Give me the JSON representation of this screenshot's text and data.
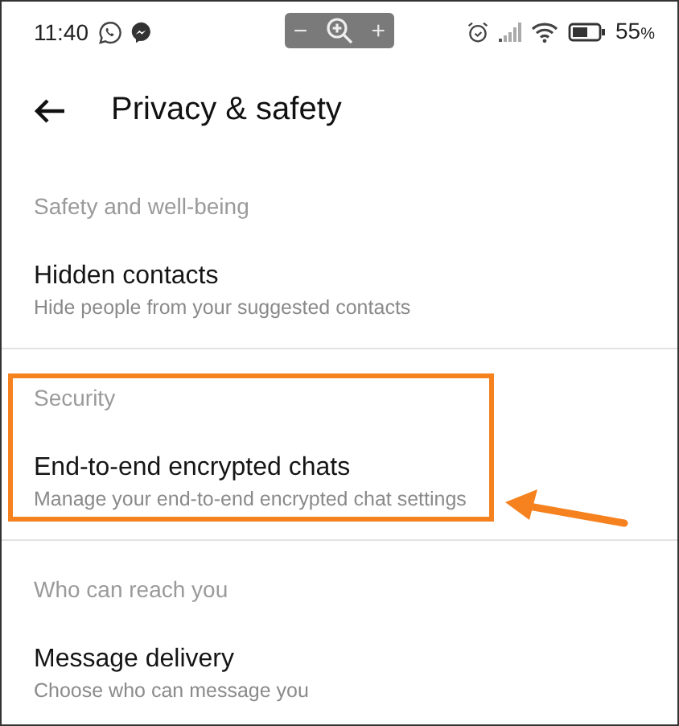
{
  "status_bar": {
    "time": "11:40",
    "zoom_control": {
      "minus": "−",
      "plus": "+"
    },
    "battery": "55",
    "battery_unit": "%"
  },
  "header": {
    "title": "Privacy & safety"
  },
  "sections": [
    {
      "title": "Safety and well-being",
      "highlighted": false,
      "items": [
        {
          "title": "Hidden contacts",
          "subtitle": "Hide people from your suggested contacts"
        }
      ]
    },
    {
      "title": "Security",
      "highlighted": true,
      "items": [
        {
          "title": "End-to-end encrypted chats",
          "subtitle": "Manage your end-to-end encrypted chat settings"
        }
      ]
    },
    {
      "title": "Who can reach you",
      "highlighted": false,
      "items": [
        {
          "title": "Message delivery",
          "subtitle": "Choose who can message you"
        }
      ]
    }
  ]
}
